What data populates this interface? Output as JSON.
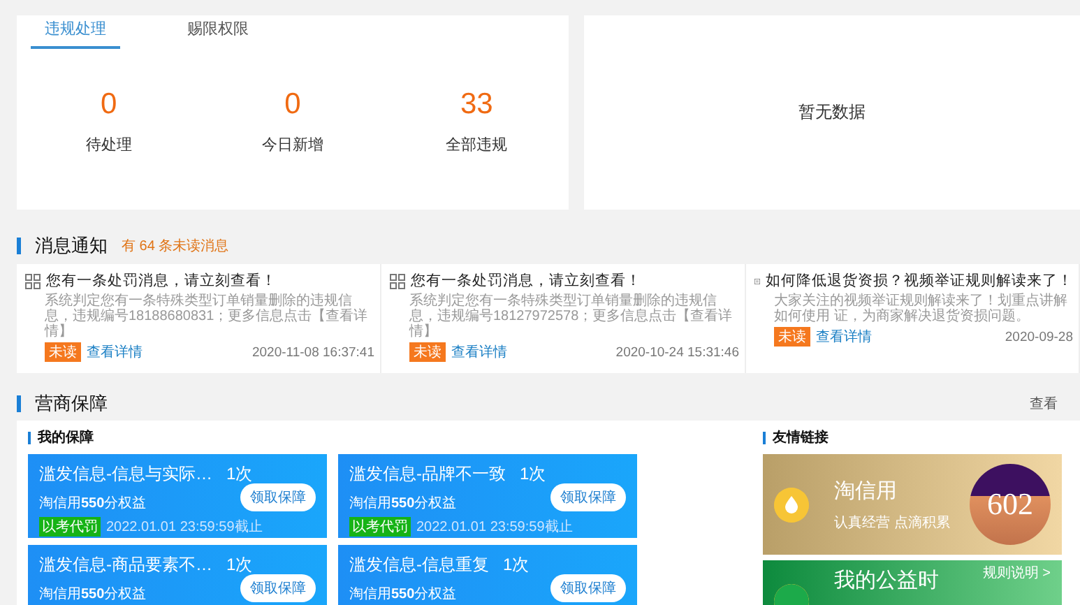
{
  "violations": {
    "tabs": [
      {
        "label": "违规处理",
        "selected": true
      },
      {
        "label": "赐限权限",
        "selected": false
      }
    ],
    "stats": [
      {
        "value": "0",
        "label": "待处理"
      },
      {
        "value": "0",
        "label": "今日新增"
      },
      {
        "value": "33",
        "label": "全部违规"
      }
    ]
  },
  "deduction": {
    "empty_text": "暂无数据"
  },
  "messages": {
    "title": "消息通知",
    "unread_text": "有 64 条未读消息",
    "items": [
      {
        "kind": "penalty",
        "title": "您有一条处罚消息，请立刻查看！",
        "body": "系统判定您有一条特殊类型订单销量删除的违规信息，违规编号18188680831；更多信息点击【查看详情】",
        "badge": "未读",
        "link": "查看详情",
        "date": "2020-11-08 16:37:41"
      },
      {
        "kind": "penalty",
        "title": "您有一条处罚消息，请立刻查看！",
        "body": "系统判定您有一条特殊类型订单销量删除的违规信息，违规编号18127972578；更多信息点击【查看详情】",
        "badge": "未读",
        "link": "查看详情",
        "date": "2020-10-24 15:31:46"
      },
      {
        "kind": "article",
        "title": "如何降低退货资损？视频举证规则解读来了！",
        "body": "大家关注的视频举证规则解读来了！划重点讲解如何使用 证，为商家解决退货资损问题。",
        "badge": "未读",
        "link": "查看详情",
        "date": "2020-09-28"
      }
    ]
  },
  "business": {
    "title": "营商保障",
    "more": "查看",
    "my_guarantee": {
      "title": "我的保障",
      "cards": [
        {
          "title": "滥发信息-信息与实际…",
          "count": "1次",
          "benefit": "淘信用**550**分权益",
          "button": "领取保障",
          "tag": "以考代罚",
          "deadline": "2022.01.01 23:59:59截止"
        },
        {
          "title": "滥发信息-品牌不一致",
          "count": "1次",
          "benefit": "淘信用**550**分权益",
          "button": "领取保障",
          "tag": "以考代罚",
          "deadline": "2022.01.01 23:59:59截止"
        },
        {
          "title": "滥发信息-商品要素不…",
          "count": "1次",
          "benefit": "淘信用**550**分权益",
          "button": "领取保障"
        },
        {
          "title": "滥发信息-信息重复",
          "count": "1次",
          "benefit": "淘信用**550**分权益",
          "button": "领取保障"
        }
      ]
    },
    "links": {
      "title": "友情链接",
      "cards": [
        {
          "kind": "credit",
          "title": "淘信用",
          "subtitle": "认真经营 点滴积累",
          "score": "602"
        },
        {
          "kind": "charity",
          "title": "我的公益时",
          "rule_link": "规则说明 >"
        }
      ]
    }
  }
}
